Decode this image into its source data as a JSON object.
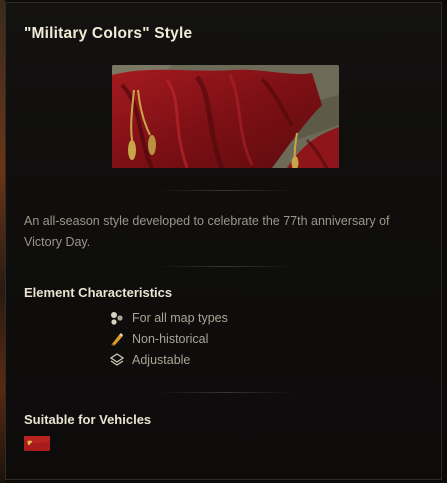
{
  "tooltip": {
    "title": "\"Military Colors\" Style",
    "description": "An all-season style developed to celebrate the 77th anniversary of Victory Day.",
    "characteristics": {
      "heading": "Element Characteristics",
      "items": [
        {
          "icon": "map-types-icon",
          "label": "For all map types"
        },
        {
          "icon": "non-historical-icon",
          "label": "Non-historical"
        },
        {
          "icon": "adjustable-icon",
          "label": "Adjustable"
        }
      ]
    },
    "vehicles": {
      "heading": "Suitable for Vehicles",
      "nation_icon": "ussr-flag-icon"
    }
  },
  "colors": {
    "title": "#f0ebd8",
    "text": "#9c968a",
    "banner_red": "#8b1418",
    "tassel_gold": "#c9a54a"
  }
}
